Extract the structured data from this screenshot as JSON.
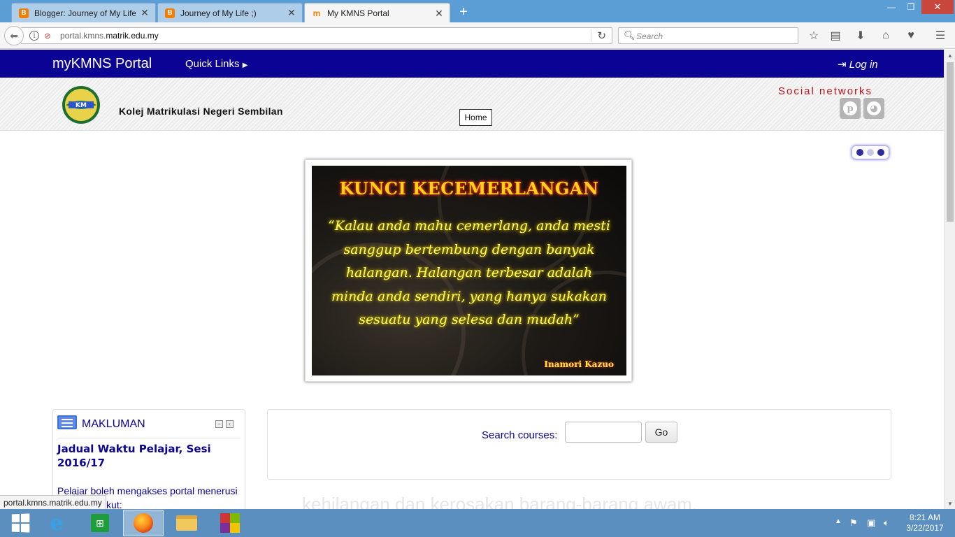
{
  "browser": {
    "tabs": [
      {
        "label": "Blogger: Journey of My Life",
        "favicon": "blogger-icon",
        "active": false
      },
      {
        "label": "Journey of My Life ;)",
        "favicon": "blogger-icon",
        "active": false
      },
      {
        "label": "My KMNS Portal",
        "favicon": "moodle-icon",
        "active": true
      }
    ],
    "url_host_prefix": "portal.kmns.",
    "url_host_main": "matrik.edu.my",
    "search_placeholder": "Search",
    "status_url": "portal.kmns.matrik.edu.my"
  },
  "site": {
    "brand": "myKMNS Portal",
    "quick_links": "Quick Links",
    "login": "Log in",
    "college_name": "Kolej Matrikulasi Negeri Sembilan",
    "home_button": "Home",
    "social_title": "Social networks",
    "social_icons": [
      "pinterest-icon",
      "globe-icon"
    ],
    "brand_color": "#0a0394"
  },
  "banner": {
    "title": "KUNCI KECEMERLANGAN",
    "quote": "“Kalau anda mahu cemerlang, anda mesti sanggup bertembung dengan banyak halangan. Halangan terbesar adalah minda anda sendiri, yang hanya sukakan sesuatu yang selesa dan mudah”",
    "author": "Inamori Kazuo",
    "slides": 3
  },
  "makluman": {
    "title": "MAKLUMAN",
    "news_title": "Jadual Waktu Pelajar, Sesi 2016/17",
    "news_body": "Pelajar boleh mengakses portal menerusi pautan berikut:"
  },
  "search_courses": {
    "label": "Search courses:",
    "value": "",
    "button": "Go"
  },
  "footer_text": "kehilangan dan kerosakan barang-barang awam.",
  "taskbar": {
    "time": "8:21 AM",
    "date": "3/22/2017"
  }
}
